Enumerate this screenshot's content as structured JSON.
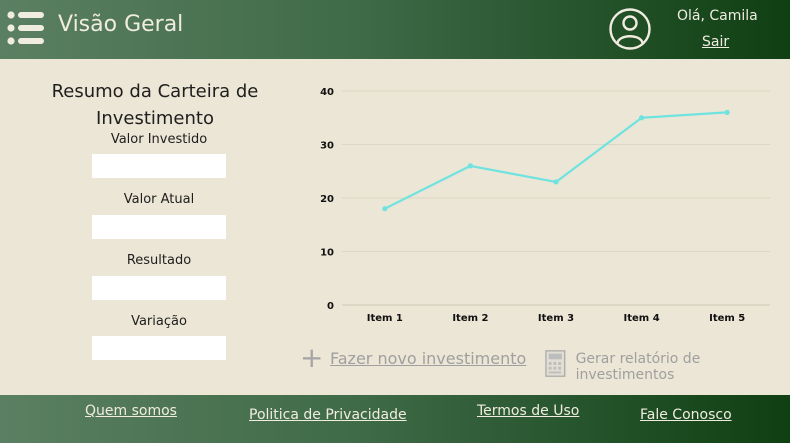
{
  "header": {
    "title": "Visão Geral",
    "greeting": "Olá, Camila",
    "logout": "Sair"
  },
  "summary": {
    "title": "Resumo da Carteira de Investimento",
    "fields": [
      {
        "label": "Valor Investido",
        "value": ""
      },
      {
        "label": "Valor Atual",
        "value": ""
      },
      {
        "label": "Resultado",
        "value": ""
      },
      {
        "label": "Variação",
        "value": ""
      }
    ]
  },
  "chart_data": {
    "type": "line",
    "categories": [
      "Item 1",
      "Item 2",
      "Item 3",
      "Item 4",
      "Item 5"
    ],
    "series": [
      {
        "values": [
          18,
          26,
          23,
          35,
          36
        ],
        "color": "#6ee3df"
      }
    ],
    "ylim": [
      0,
      40
    ],
    "yticks": [
      0,
      10,
      20,
      30,
      40
    ],
    "grid": true
  },
  "actions": {
    "new_investment": "Fazer novo investimento",
    "report": "Gerar relatório de investimentos"
  },
  "footer": {
    "links": [
      "Quem somos",
      "Politica de Privacidade",
      "Termos de Uso",
      "Fale Conosco"
    ]
  },
  "colors": {
    "header_start": "#5b7f62",
    "header_end": "#0f3f12",
    "background": "#ece6d6",
    "line": "#6ee3df"
  }
}
